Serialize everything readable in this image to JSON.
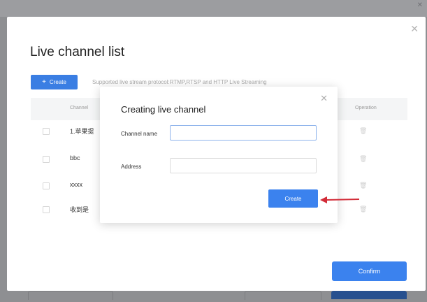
{
  "colors": {
    "accent": "#3b82ee",
    "arrow": "#d22b37"
  },
  "backdrop": {
    "close_icon": "close-icon"
  },
  "modal": {
    "title": "Live channel list",
    "create_button": {
      "plus": "+",
      "label": "Create"
    },
    "support_text": "Supported live stream protocol:RTMP,RTSP and HTTP Live Streaming",
    "columns": {
      "channel": "Channel",
      "operation": "Operation"
    },
    "rows": [
      {
        "name": "1.苹果提"
      },
      {
        "name": "bbc"
      },
      {
        "name": "xxxx"
      },
      {
        "name": "收到是"
      }
    ],
    "operation_icon": "delete-icon",
    "confirm_label": "Confirm"
  },
  "dialog": {
    "title": "Creating live channel",
    "channel_name_label": "Channel name",
    "channel_name_value": "",
    "address_label": "Address",
    "address_value": "",
    "create_label": "Create",
    "close_icon": "close-icon"
  }
}
